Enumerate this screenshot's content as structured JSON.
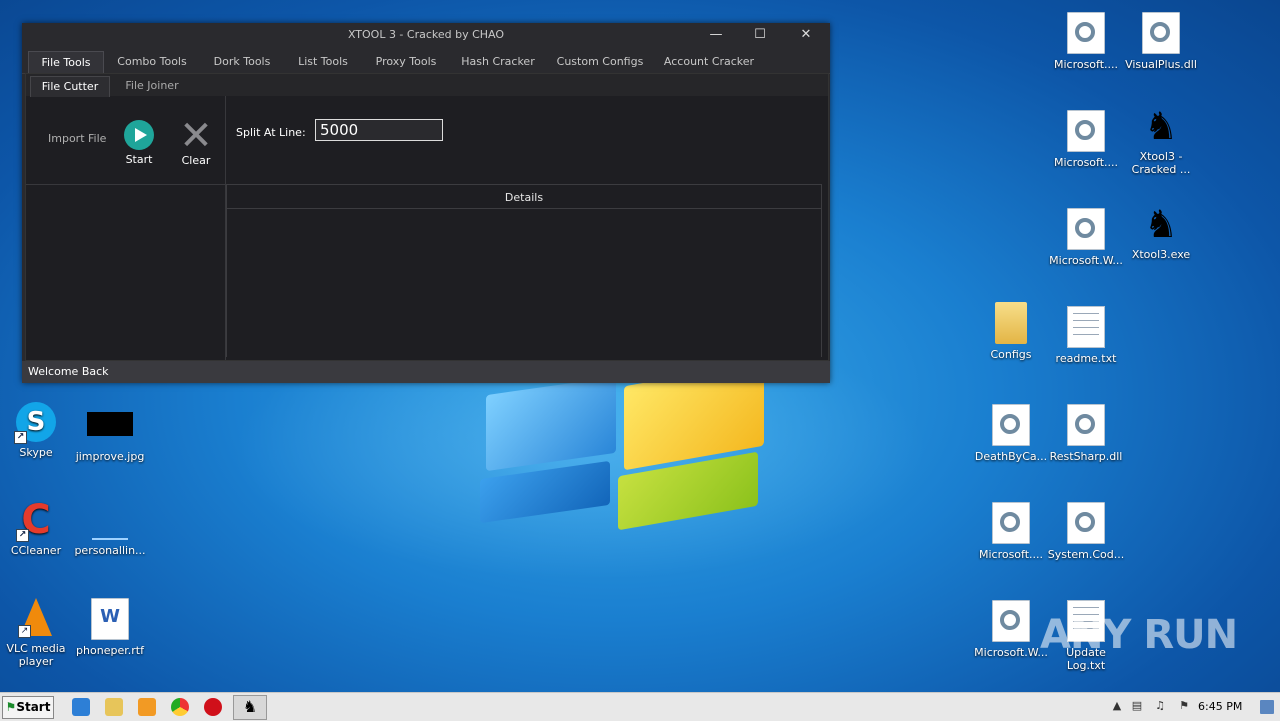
{
  "desktop": {
    "left_icons": [
      {
        "label": "Skype"
      },
      {
        "label": "jimprove.jpg"
      },
      {
        "label": "CCleaner"
      },
      {
        "label": "personallin..."
      },
      {
        "label": "VLC media player"
      },
      {
        "label": "phoneper.rtf"
      }
    ],
    "right_icons": [
      {
        "label": "Microsoft...."
      },
      {
        "label": "VisualPlus.dll"
      },
      {
        "label": "Microsoft...."
      },
      {
        "label": "Xtool3 - Cracked ..."
      },
      {
        "label": "Microsoft.W..."
      },
      {
        "label": "Xtool3.exe"
      },
      {
        "label": "Configs"
      },
      {
        "label": "readme.txt"
      },
      {
        "label": "DeathByCa..."
      },
      {
        "label": "RestSharp.dll"
      },
      {
        "label": "Microsoft...."
      },
      {
        "label": "System.Cod..."
      },
      {
        "label": "Microsoft.W..."
      },
      {
        "label": "Update Log.txt"
      }
    ],
    "watermark": "ANY RUN"
  },
  "app": {
    "title": "XTOOL 3 - Cracked by CHAO",
    "main_tabs": [
      "File Tools",
      "Combo Tools",
      "Dork Tools",
      "List Tools",
      "Proxy Tools",
      "Hash Cracker",
      "Custom Configs",
      "Account Cracker"
    ],
    "active_main_tab": "File Tools",
    "sub_tabs": [
      "File Cutter",
      "File Joiner"
    ],
    "active_sub_tab": "File Cutter",
    "import_label": "Import File",
    "start_label": "Start",
    "clear_label": "Clear",
    "split_label": "Split At Line:",
    "split_value": "5000",
    "details_header": "Details",
    "status": "Welcome Back"
  },
  "taskbar": {
    "start_label": "Start",
    "clock": "6:45 PM"
  },
  "colors": {
    "app_bg": "#2a2a2e",
    "accent_teal": "#1fa59a",
    "desktop_blue": "#1a7fd0"
  }
}
